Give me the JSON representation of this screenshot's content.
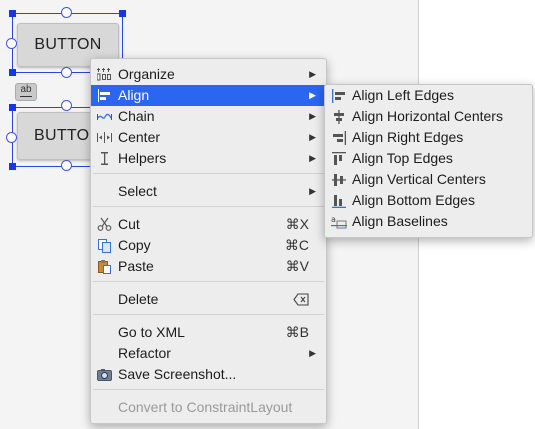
{
  "design": {
    "button_top": "BUTTON",
    "button_bottom": "BUTTON",
    "baseline_chip": "ab"
  },
  "menu": {
    "items": [
      {
        "label": "Organize",
        "submenu": true,
        "icon": "organize-icon"
      },
      {
        "label": "Align",
        "submenu": true,
        "icon": "align-icon",
        "highlighted": true
      },
      {
        "label": "Chain",
        "submenu": true,
        "icon": "chain-icon"
      },
      {
        "label": "Center",
        "submenu": true,
        "icon": "center-icon"
      },
      {
        "label": "Helpers",
        "submenu": true,
        "icon": "helpers-icon"
      },
      {
        "label": "Select",
        "submenu": true
      },
      {
        "label": "Cut",
        "shortcut": "⌘X",
        "icon": "scissors-icon"
      },
      {
        "label": "Copy",
        "shortcut": "⌘C",
        "icon": "copy-icon"
      },
      {
        "label": "Paste",
        "shortcut": "⌘V",
        "icon": "paste-icon"
      },
      {
        "label": "Delete",
        "icon": "delete-key-icon"
      },
      {
        "label": "Go to XML",
        "shortcut": "⌘B"
      },
      {
        "label": "Refactor",
        "submenu": true
      },
      {
        "label": "Save Screenshot...",
        "icon": "camera-icon"
      },
      {
        "label": "Convert to ConstraintLayout",
        "disabled": true
      }
    ]
  },
  "submenu": {
    "items": [
      {
        "label": "Align Left Edges",
        "icon": "align-left-edges-icon"
      },
      {
        "label": "Align Horizontal Centers",
        "icon": "align-horizontal-centers-icon"
      },
      {
        "label": "Align Right Edges",
        "icon": "align-right-edges-icon"
      },
      {
        "label": "Align Top Edges",
        "icon": "align-top-edges-icon"
      },
      {
        "label": "Align Vertical Centers",
        "icon": "align-vertical-centers-icon"
      },
      {
        "label": "Align Bottom Edges",
        "icon": "align-bottom-edges-icon"
      },
      {
        "label": "Align Baselines",
        "icon": "align-baselines-icon"
      }
    ]
  },
  "colors": {
    "highlight": "#2a66f0",
    "selection": "#2a45e0",
    "icon_blue": "#3a6fd8"
  }
}
